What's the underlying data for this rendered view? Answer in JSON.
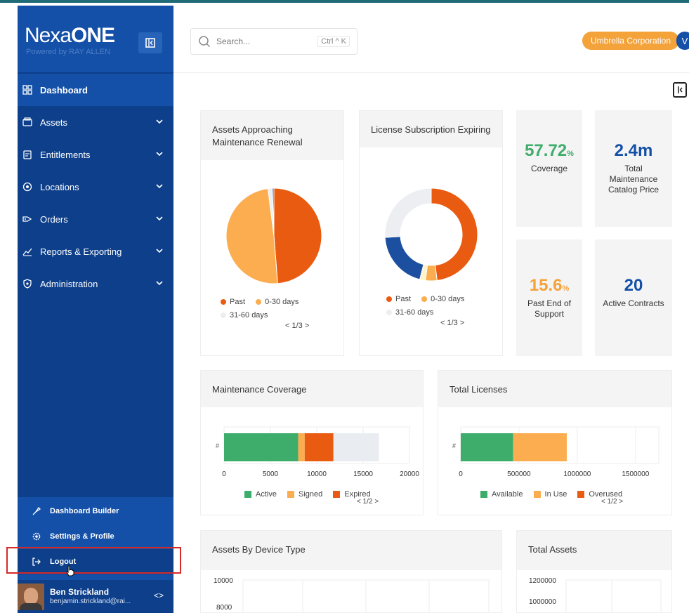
{
  "sidebar": {
    "brand": {
      "name_part1": "Nexa",
      "name_part2": "ONE",
      "tagline": "Powered by RAY ALLEN"
    },
    "nav": [
      {
        "label": "Dashboard",
        "icon": "dashboard-icon"
      },
      {
        "label": "Assets",
        "icon": "assets-icon"
      },
      {
        "label": "Entitlements",
        "icon": "entitlements-icon"
      },
      {
        "label": "Locations",
        "icon": "location-pin-icon"
      },
      {
        "label": "Orders",
        "icon": "tag-icon"
      },
      {
        "label": "Reports & Exporting",
        "icon": "chart-icon"
      },
      {
        "label": "Administration",
        "icon": "shield-gear-icon"
      }
    ],
    "bottom": [
      {
        "label": "Dashboard Builder",
        "icon": "builder-icon"
      },
      {
        "label": "Settings & Profile",
        "icon": "gear-icon"
      },
      {
        "label": "Logout",
        "icon": "logout-icon"
      }
    ],
    "user": {
      "name": "Ben Strickland",
      "email": "benjamin.strickland@rai..."
    }
  },
  "topbar": {
    "search_placeholder": "Search...",
    "shortcut": "Ctrl ^ K",
    "org": "Umbrella Corporation",
    "user_initial": "V"
  },
  "colors": {
    "sidebar": "#0d3f8a",
    "sidebar_active": "#1450a8",
    "accent_orange": "#f4a23a",
    "past": "#ea5b12",
    "days_0_30": "#fbad4f",
    "days_31_60": "#eceef1",
    "blue_series": "#1c4fa0",
    "active_green": "#3ead6c",
    "kpi_green": "#3ead6c",
    "kpi_blue": "#1450a8",
    "kpi_orange": "#f4a23a"
  },
  "cards": {
    "assets_renewal": {
      "title": "Assets Approaching Maintenance Renewal",
      "pager": "< 1/3 >"
    },
    "license_expiring": {
      "title": "License Subscription Expiring",
      "pager": "< 1/3 >"
    },
    "kpis": [
      {
        "value": "57.72",
        "unit": "%",
        "label": "Coverage"
      },
      {
        "value": "2.4m",
        "unit": "",
        "label": "Total Maintenance Catalog Price"
      },
      {
        "value": "15.6",
        "unit": "%",
        "label": "Past End of Support"
      },
      {
        "value": "20",
        "unit": "",
        "label": "Active Contracts"
      }
    ],
    "maint_coverage": {
      "title": "Maintenance Coverage",
      "pager": "< 1/2 >"
    },
    "total_licenses": {
      "title": "Total Licenses",
      "pager": "< 1/2 >"
    },
    "device_type": {
      "title": "Assets By Device Type"
    },
    "total_assets": {
      "title": "Total Assets"
    }
  },
  "chart_data": [
    {
      "type": "pie",
      "title": "Assets Approaching Maintenance Renewal",
      "categories": [
        "Past",
        "0-30 days",
        "31-60 days"
      ],
      "values": [
        49,
        49.5,
        1.5
      ],
      "extra_slice_colors": [
        "#1c4fa0"
      ]
    },
    {
      "type": "pie",
      "style": "donut",
      "title": "License Subscription Expiring",
      "categories": [
        "Past",
        "0-30 days",
        "31-60 days"
      ],
      "values": [
        48,
        4,
        26
      ],
      "extra_slices": [
        {
          "color": "#1c4fa0",
          "value": 20
        },
        {
          "color": "#fff4c7",
          "value": 2
        }
      ]
    },
    {
      "type": "bar",
      "orientation": "horizontal",
      "stacked": true,
      "title": "Maintenance Coverage",
      "categories": [
        "#"
      ],
      "series": [
        {
          "name": "Active",
          "values": [
            8000
          ]
        },
        {
          "name": "Signed",
          "values": [
            700
          ]
        },
        {
          "name": "Expired",
          "values": [
            3100
          ]
        },
        {
          "name": "",
          "values": [
            4900
          ]
        }
      ],
      "xticks": [
        "0",
        "5000",
        "10000",
        "15000",
        "20000"
      ],
      "xlim": [
        0,
        20000
      ]
    },
    {
      "type": "bar",
      "orientation": "horizontal",
      "stacked": true,
      "title": "Total Licenses",
      "categories": [
        "#"
      ],
      "series": [
        {
          "name": "Available",
          "values": [
            450000
          ]
        },
        {
          "name": "In Use",
          "values": [
            460000
          ]
        },
        {
          "name": "Overused",
          "values": [
            0
          ]
        }
      ],
      "xticks": [
        "0",
        "500000",
        "1000000",
        "1500000"
      ],
      "xlim": [
        0,
        1700000
      ]
    },
    {
      "type": "bar",
      "title": "Assets By Device Type",
      "yticks": [
        "10000",
        "8000"
      ]
    },
    {
      "type": "bar",
      "title": "Total Assets",
      "yticks": [
        "1200000",
        "1000000"
      ]
    }
  ]
}
